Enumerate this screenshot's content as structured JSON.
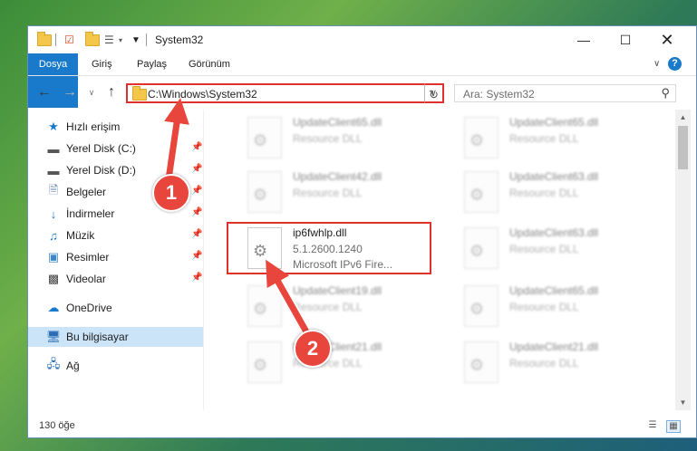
{
  "window": {
    "title": "System32",
    "quick_access_icons": [
      "folder-icon",
      "check-icon",
      "folder-icon",
      "properties-icon"
    ],
    "controls": [
      "minimize-icon",
      "maximize-icon",
      "close-icon"
    ]
  },
  "ribbon": {
    "tabs": [
      "Dosya",
      "Giriş",
      "Paylaş",
      "Görünüm"
    ],
    "accent": "#1979ca"
  },
  "address": {
    "path": "C:\\Windows\\System32",
    "search_placeholder": "Ara: System32"
  },
  "nav": {
    "items": [
      {
        "label": "Hızlı erişim",
        "icon": "star-icon"
      },
      {
        "label": "Yerel Disk (C:)",
        "icon": "drive-icon",
        "pinned": true
      },
      {
        "label": "Yerel Disk (D:)",
        "icon": "drive-icon",
        "pinned": true
      },
      {
        "label": "Belgeler",
        "icon": "document-icon",
        "pinned": true
      },
      {
        "label": "İndirmeler",
        "icon": "download-icon",
        "pinned": true
      },
      {
        "label": "Müzik",
        "icon": "music-icon",
        "pinned": true
      },
      {
        "label": "Resimler",
        "icon": "pictures-icon",
        "pinned": true
      },
      {
        "label": "Videolar",
        "icon": "video-icon",
        "pinned": true
      },
      {
        "label": "OneDrive",
        "icon": "cloud-icon"
      },
      {
        "label": "Bu bilgisayar",
        "icon": "computer-icon",
        "selected": true
      },
      {
        "label": "Ağ",
        "icon": "network-icon"
      }
    ]
  },
  "files": {
    "left": [
      {
        "name": "UpdateClient65.dll",
        "type": "Resource DLL"
      },
      {
        "name": "UpdateClient42.dll",
        "type": "Resource DLL"
      },
      {
        "name": "ip6fwhlp.dll",
        "version": "5.1.2600.1240",
        "description": "Microsoft IPv6 Fire..."
      },
      {
        "name": "UpdateClient19.dll",
        "type": "Resource DLL"
      },
      {
        "name": "UpdateClient21.dll",
        "type": "Resource DLL"
      }
    ],
    "right": [
      {
        "name": "UpdateClient65.dll",
        "type": "Resource DLL"
      },
      {
        "name": "UpdateClient63.dll",
        "type": "Resource DLL"
      },
      {
        "name": "UpdateClient63.dll",
        "type": "Resource DLL"
      },
      {
        "name": "UpdateClient65.dll",
        "type": "Resource DLL"
      },
      {
        "name": "UpdateClient21.dll",
        "type": "Resource DLL"
      }
    ]
  },
  "status": {
    "item_count": "130 öğe"
  },
  "annotations": {
    "step1": "1",
    "step2": "2",
    "color": "#e0322c"
  }
}
